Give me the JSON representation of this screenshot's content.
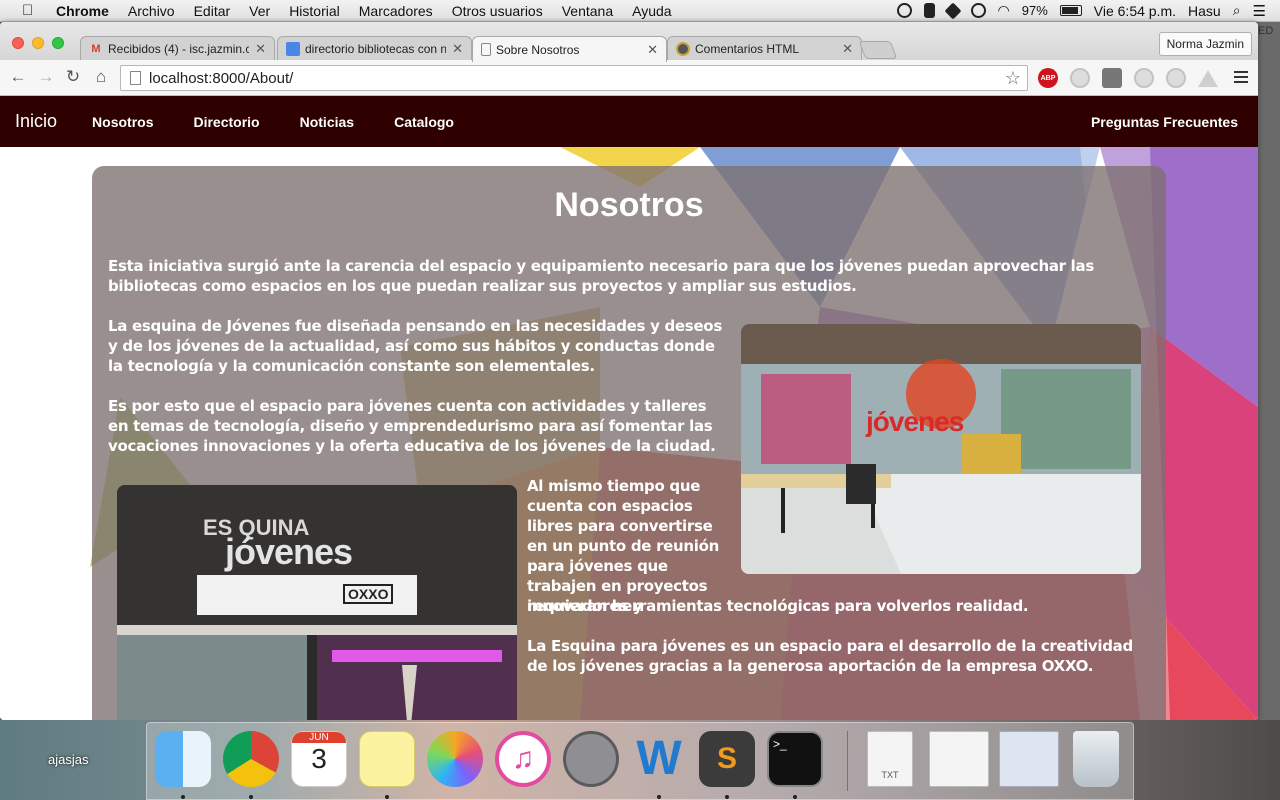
{
  "menubar": {
    "app": "Chrome",
    "items": [
      "Archivo",
      "Editar",
      "Ver",
      "Historial",
      "Marcadores",
      "Otros usuarios",
      "Ventana",
      "Ayuda"
    ],
    "battery": "97%",
    "clock": "Vie 6:54 p.m.",
    "user": "Hasu"
  },
  "browser": {
    "tabs": [
      {
        "title": "Recibidos (4) - isc.jazmin.c",
        "icon": "gmail-icon"
      },
      {
        "title": "directorio bibliotecas con n",
        "icon": "docs-icon"
      },
      {
        "title": "Sobre Nosotros",
        "icon": "page-icon"
      },
      {
        "title": "Comentarios HTML",
        "icon": "site-icon"
      }
    ],
    "profile": "Norma Jazmin",
    "url": "localhost:8000/About/",
    "abp_label": "ABP"
  },
  "site": {
    "brand": "Inicio",
    "nav": [
      "Nosotros",
      "Directorio",
      "Noticias",
      "Catalogo"
    ],
    "nav_right": "Preguntas Frecuentes",
    "heading": "Nosotros",
    "p1": "Esta iniciativa surgió ante la carencia del espacio y equipamiento necesario para que los jóvenes puedan aprovechar las bibliotecas como espacios en los que puedan realizar sus proyectos y ampliar sus estudios.",
    "p2": "La esquina de Jóvenes fue diseñada pensando en las necesidades y deseos y de los jóvenes de la actualidad, así como sus hábitos y conductas donde la tecnología y la comunicación constante son elementales.",
    "p3": "Es por esto que el espacio para jóvenes cuenta con actividades y talleres en temas de tecnología, diseño y emprendedurismo para así fomentar las vocaciones innovaciones y la oferta educativa de los jóvenes de la ciudad.",
    "p4a": "Al mismo tiempo que cuenta con espacios libres para convertirse en un punto de reunión para jóvenes que trabajen en proyectos innovadores y",
    "p4b": "requieran herramientas tecnológicas para volverlos realidad.",
    "p5": "La Esquina para jóvenes es un espacio para el desarrollo de la creatividad de los jóvenes gracias a la generosa aportación de la empresa OXXO.",
    "photo_lounge_sign": "jóvenes",
    "photo_entrance_sign_1": "ES QUINA",
    "photo_entrance_sign_2": "jóvenes",
    "photo_entrance_sign_3": "OXXO"
  },
  "desktop": {
    "folder_label": "ajasjas",
    "edge_label": "ED",
    "calendar_month": "JUN",
    "calendar_day": "3",
    "txt_label": "TXT"
  }
}
